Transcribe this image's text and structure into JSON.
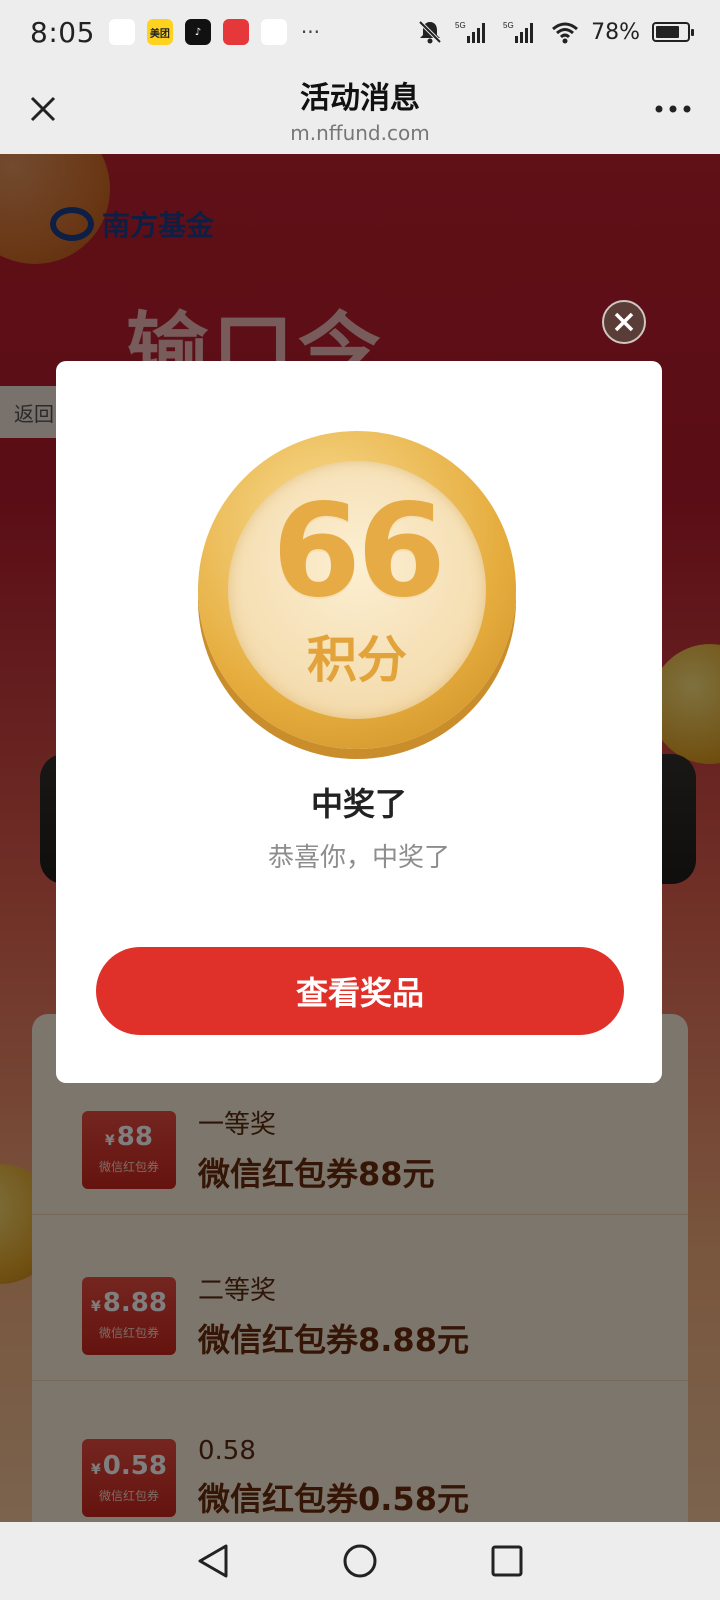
{
  "status_bar": {
    "time": "8:05",
    "apps": [
      {
        "name": "ccb-app-icon",
        "text": "",
        "bg": "#ffffff",
        "fg": "#1f5ea8"
      },
      {
        "name": "meituan-app-icon",
        "text": "美团",
        "bg": "#ffd21f",
        "fg": "#222222"
      },
      {
        "name": "douyin-app-icon",
        "text": "♪",
        "bg": "#111111",
        "fg": "#ffffff"
      },
      {
        "name": "game-app-icon",
        "text": "",
        "bg": "#e6383a",
        "fg": "#ffffff"
      },
      {
        "name": "shield-app-icon",
        "text": "",
        "bg": "#ffffff",
        "fg": "#1f8be8"
      }
    ],
    "more": "···",
    "battery_percent": "78%",
    "battery_level": 0.78
  },
  "title_bar": {
    "title": "活动消息",
    "url": "m.nffund.com"
  },
  "background": {
    "logo_text": "南方基金",
    "hero_title": "输口令",
    "back_label": "返回",
    "prizes": [
      {
        "coupon_value": "88",
        "rank": "一等奖",
        "name": "微信红包券88元"
      },
      {
        "coupon_value": "8.88",
        "rank": "二等奖",
        "name": "微信红包券8.88元"
      },
      {
        "coupon_value": "0.58",
        "rank": "0.58",
        "name": "微信红包券0.58元"
      }
    ],
    "coupon_currency": "¥",
    "coupon_label": "微信红包券"
  },
  "modal": {
    "medal_number": "66",
    "medal_unit": "积分",
    "title": "中奖了",
    "subtitle": "恭喜你，中奖了",
    "button_label": "查看奖品"
  },
  "colors": {
    "accent_red": "#e0302a",
    "gold": "#e6ab44"
  }
}
